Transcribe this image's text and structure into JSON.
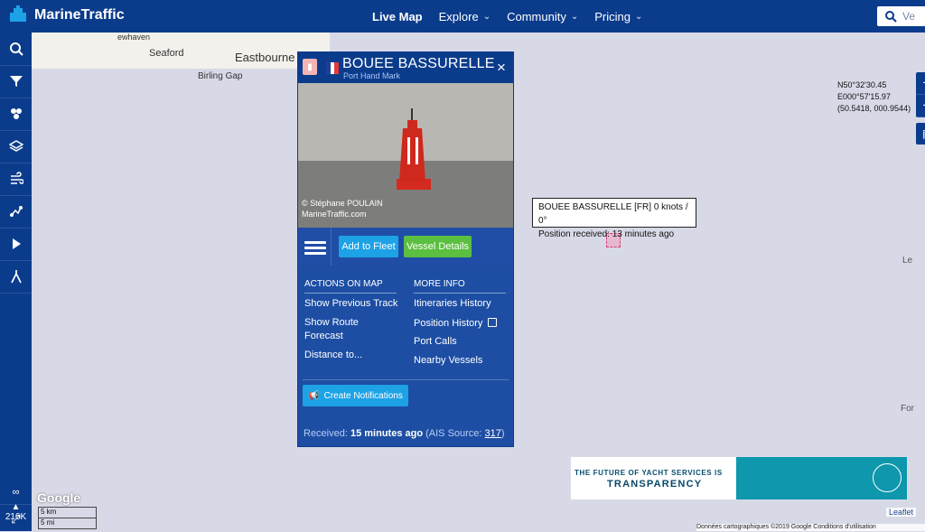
{
  "topbar": {
    "brand": "MarineTraffic",
    "nav": [
      {
        "label": "Live Map",
        "active": true
      },
      {
        "label": "Explore",
        "has_dropdown": true
      },
      {
        "label": "Community",
        "has_dropdown": true
      },
      {
        "label": "Pricing",
        "has_dropdown": true
      }
    ],
    "search_placeholder": "Ve"
  },
  "sidebar": {
    "icons": [
      "search-icon",
      "filter-icon",
      "density-icon",
      "layers-icon",
      "weather-icon",
      "routes-icon",
      "play-icon",
      "measure-icon"
    ],
    "vessel_count": "216K",
    "footer_badge": "∞"
  },
  "map": {
    "coords": [
      "N50°32'30.45",
      "E000°57'15.97",
      "(50.5418, 000.9544)"
    ],
    "zoom_in": "+",
    "zoom_out": "−",
    "labels": [
      {
        "text": "Seaford"
      },
      {
        "text": "Eastbourne"
      },
      {
        "text": "Birling Gap"
      },
      {
        "text": "ewhaven"
      },
      {
        "text": "Le"
      },
      {
        "text": "For"
      }
    ],
    "google": "Google",
    "scale_km": "5 km",
    "scale_mi": "5 mi",
    "attribution": "Données cartographiques ©2019 Google   Conditions d'utilisation",
    "leaflet": "Leaflet"
  },
  "popup": {
    "title": "BOUEE BASSURELLE",
    "subtitle": "Port Hand Mark",
    "close": "×",
    "photo_credit": "© Stéphane POULAIN",
    "photo_site": "MarineTraffic.com",
    "buttons": {
      "add_to_fleet": "Add to Fleet",
      "vessel_details": "Vessel Details"
    },
    "actions_title": "ACTIONS ON MAP",
    "actions": [
      "Show Previous Track",
      "Show Route",
      "Forecast",
      "Distance to..."
    ],
    "more_title": "MORE INFO",
    "more": [
      "Itineraries History",
      "Position History",
      "Port Calls",
      "Nearby Vessels"
    ],
    "notify_label": "Create Notifications",
    "received_prefix": "Received:",
    "received_value": "15 minutes ago",
    "ais_prefix": "(AIS Source:",
    "ais_value": "317",
    "ais_suffix": ")"
  },
  "tooltip": {
    "line1": "BOUEE BASSURELLE [FR] 0 knots / 0°",
    "line2": "Position received: 13 minutes ago"
  },
  "ad": {
    "line1": "THE FUTURE OF YACHT SERVICES IS",
    "line2": "TRANSPARENCY"
  }
}
